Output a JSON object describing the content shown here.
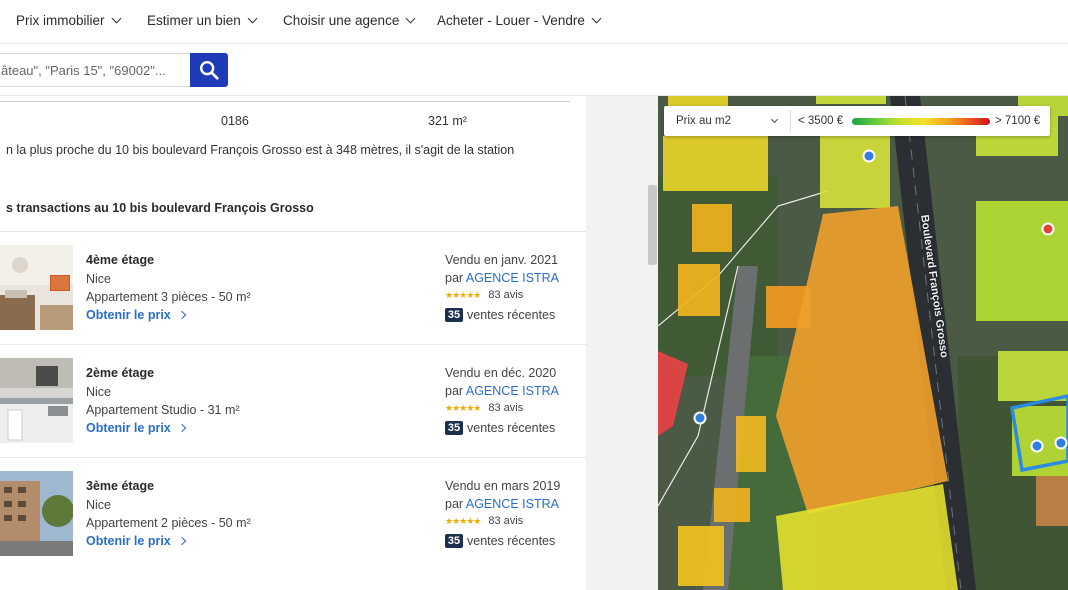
{
  "nav": {
    "items": [
      "Prix immobilier",
      "Estimer un bien",
      "Choisir une agence",
      "Acheter - Louer - Vendre"
    ]
  },
  "search": {
    "placeholder": "âteau\", \"Paris 15\", \"69002\"..."
  },
  "info": {
    "code": "0186",
    "surface": "321 m²",
    "station_text": "n la plus proche du 10 bis boulevard François Grosso est à 348 mètres, il s'agit de la station",
    "section_title": "s transactions au 10 bis boulevard François Grosso"
  },
  "transactions": [
    {
      "floor": "4ème étage",
      "city": "Nice",
      "type": "Appartement 3 pièces - 50 m²",
      "link": "Obtenir le prix",
      "sold": "Vendu en janv. 2021",
      "by_prefix": "par",
      "agency": "AGENCE ISTRA",
      "stars": "★★★★★",
      "reviews": "83 avis",
      "recent_count": "35",
      "recent_label": "ventes récentes"
    },
    {
      "floor": "2ème étage",
      "city": "Nice",
      "type": "Appartement Studio - 31 m²",
      "link": "Obtenir le prix",
      "sold": "Vendu en déc. 2020",
      "by_prefix": "par",
      "agency": "AGENCE ISTRA",
      "stars": "★★★★★",
      "reviews": "83 avis",
      "recent_count": "35",
      "recent_label": "ventes récentes"
    },
    {
      "floor": "3ème étage",
      "city": "Nice",
      "type": "Appartement 2 pièces - 50 m²",
      "link": "Obtenir le prix",
      "sold": "Vendu en mars 2019",
      "by_prefix": "par",
      "agency": "AGENCE ISTRA",
      "stars": "★★★★★",
      "reviews": "83 avis",
      "recent_count": "35",
      "recent_label": "ventes récentes"
    }
  ],
  "map": {
    "legend_select": "Prix au m2",
    "legend_min": "< 3500 €",
    "legend_max": "> 7100 €",
    "street_name": "Boulevard François Grosso"
  },
  "colors": {
    "search_button": "#1e3bb8",
    "link": "#2a6dd0",
    "badge": "#1d2f4e"
  }
}
